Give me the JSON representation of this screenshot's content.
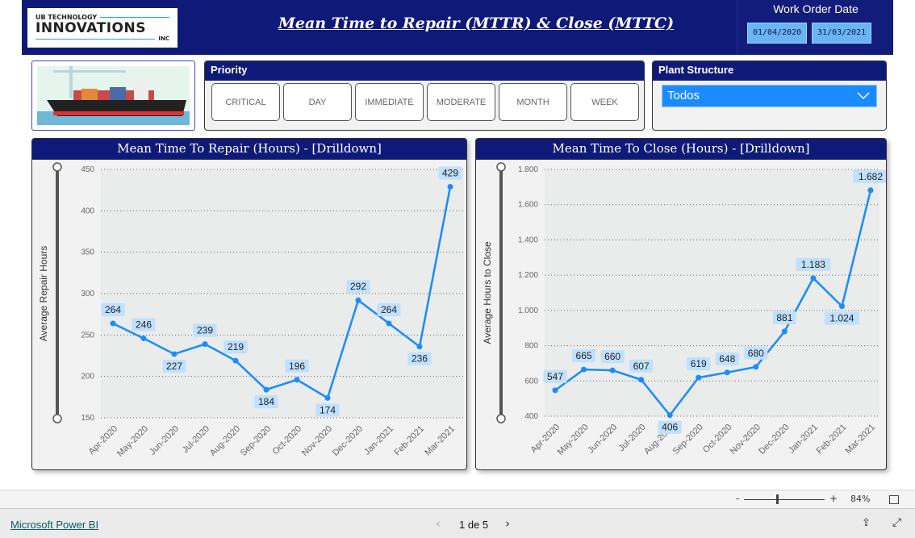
{
  "header": {
    "logo": {
      "line1": "UB TECHNOLOGY",
      "line2": "INNOVATIONS",
      "line3": "INC"
    },
    "title": "Mean Time to Repair (MTTR) & Close (MTTC)",
    "date_filter": {
      "label": "Work Order Date",
      "start": "01/04/2020",
      "end": "31/03/2021"
    }
  },
  "priority": {
    "title": "Priority",
    "options": [
      "CRITICAL",
      "DAY",
      "IMMEDIATE",
      "MODERATE",
      "MONTH",
      "WEEK"
    ]
  },
  "plant": {
    "title": "Plant Structure",
    "selected": "Todos"
  },
  "colors": {
    "header": "#0f1a78",
    "line": "#1a8cff",
    "label_bg": "#bfe0ff"
  },
  "chart_data": [
    {
      "type": "line",
      "title": "Mean Time To Repair (Hours) - [Drilldown]",
      "ylabel": "Average Repair Hours",
      "xlabel": "",
      "categories": [
        "Apr-2020",
        "May-2020",
        "Jun-2020",
        "Jul-2020",
        "Aug-2020",
        "Sep-2020",
        "Oct-2020",
        "Nov-2020",
        "Dec-2020",
        "Jan-2021",
        "Feb-2021",
        "Mar-2021"
      ],
      "values": [
        264,
        246,
        227,
        239,
        219,
        184,
        196,
        174,
        292,
        264,
        236,
        429
      ],
      "labels": [
        "264",
        "246",
        "227",
        "239",
        "219",
        "184",
        "196",
        "174",
        "292",
        "264",
        "236",
        "429"
      ],
      "yticks": [
        150,
        200,
        250,
        300,
        350,
        400,
        450
      ],
      "ytick_labels": [
        "150",
        "200",
        "250",
        "300",
        "350",
        "400",
        "450"
      ],
      "ylim": [
        150,
        450
      ],
      "grid": true
    },
    {
      "type": "line",
      "title": "Mean Time To Close (Hours) - [Drilldown]",
      "ylabel": "Average Hours to Close",
      "xlabel": "",
      "categories": [
        "Apr-2020",
        "May-2020",
        "Jun-2020",
        "Jul-2020",
        "Aug-2020",
        "Sep-2020",
        "Oct-2020",
        "Nov-2020",
        "Dec-2020",
        "Jan-2021",
        "Feb-2021",
        "Mar-2021"
      ],
      "values": [
        547,
        665,
        660,
        607,
        406,
        619,
        648,
        680,
        881,
        1183,
        1024,
        1682
      ],
      "labels": [
        "547",
        "665",
        "660",
        "607",
        "406",
        "619",
        "648",
        "680",
        "881",
        "1.183",
        "1.024",
        "1.682"
      ],
      "yticks": [
        400,
        600,
        800,
        1000,
        1200,
        1400,
        1600,
        1800
      ],
      "ytick_labels": [
        "400",
        "600",
        "800",
        "1.000",
        "1.200",
        "1.400",
        "1.600",
        "1.800"
      ],
      "ylim": [
        400,
        1800
      ],
      "grid": true
    }
  ],
  "statusbar": {
    "zoom_minus": "-",
    "zoom_plus": "+",
    "zoom": "84%",
    "zoom_level": 84
  },
  "footer": {
    "brand": "Microsoft Power BI",
    "page": "1 de 5"
  }
}
